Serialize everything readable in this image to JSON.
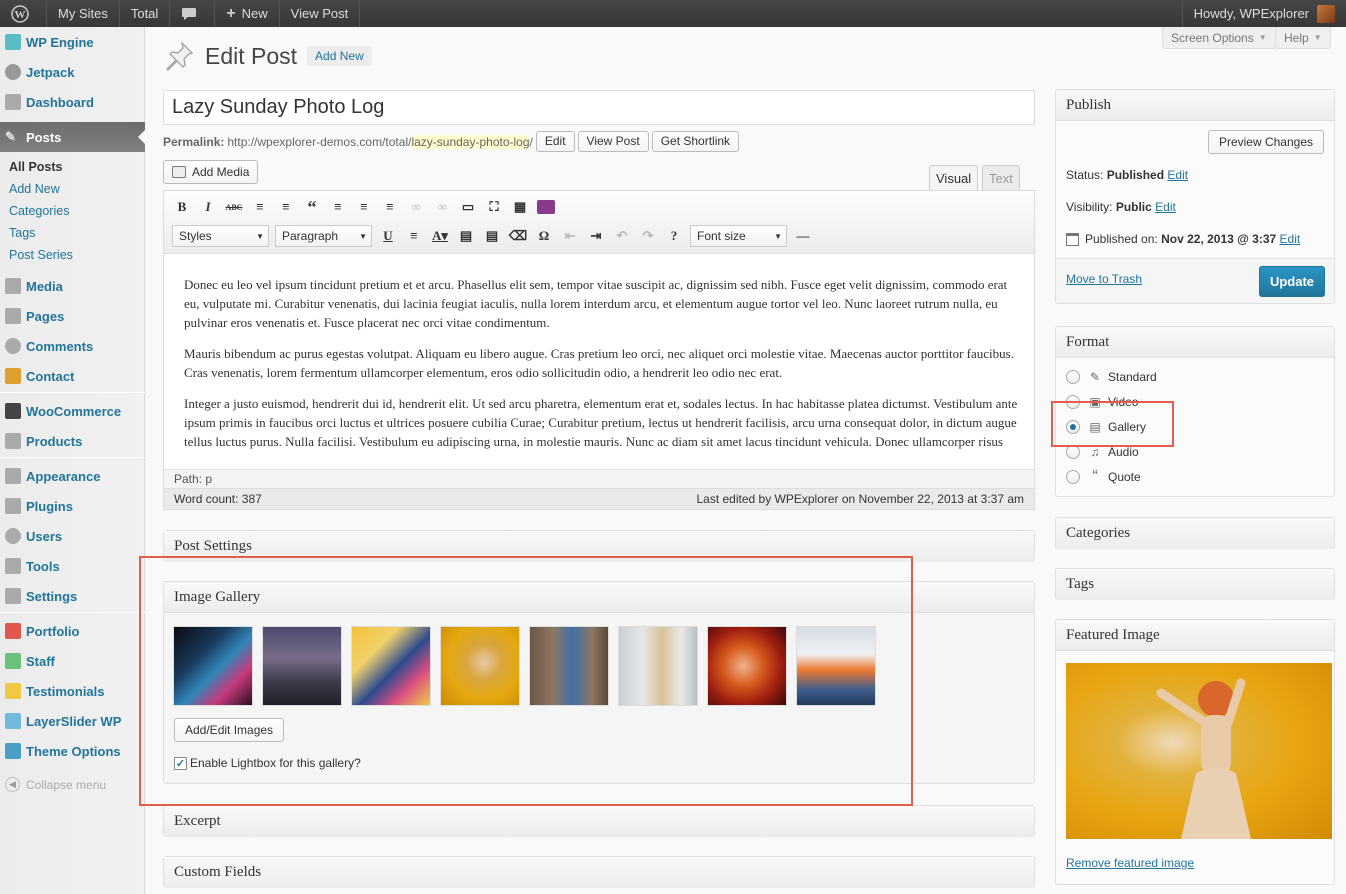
{
  "adminbar": {
    "my_sites": "My Sites",
    "site": "Total",
    "new": "New",
    "view_post": "View Post",
    "howdy": "Howdy, WPExplorer"
  },
  "sidebar": {
    "items": [
      {
        "label": "WP Engine",
        "icon": "wp-engine-icon",
        "color": "#5bbcc6"
      },
      {
        "label": "Jetpack",
        "icon": "jetpack-icon",
        "color": "#888888"
      },
      {
        "label": "Dashboard",
        "icon": "dashboard-icon",
        "color": "#888888"
      },
      {
        "label": "Posts",
        "icon": "pushpin-icon",
        "color": "#dddddd"
      },
      {
        "label": "Media",
        "icon": "media-icon",
        "color": "#888888"
      },
      {
        "label": "Pages",
        "icon": "pages-icon",
        "color": "#888888"
      },
      {
        "label": "Comments",
        "icon": "comments-icon",
        "color": "#888888"
      },
      {
        "label": "Contact",
        "icon": "contact-icon",
        "color": "#e0a030"
      },
      {
        "label": "WooCommerce",
        "icon": "woocommerce-icon",
        "color": "#444444"
      },
      {
        "label": "Products",
        "icon": "products-icon",
        "color": "#888888"
      },
      {
        "label": "Appearance",
        "icon": "appearance-icon",
        "color": "#888888"
      },
      {
        "label": "Plugins",
        "icon": "plugins-icon",
        "color": "#888888"
      },
      {
        "label": "Users",
        "icon": "users-icon",
        "color": "#888888"
      },
      {
        "label": "Tools",
        "icon": "tools-icon",
        "color": "#888888"
      },
      {
        "label": "Settings",
        "icon": "settings-icon",
        "color": "#888888"
      },
      {
        "label": "Portfolio",
        "icon": "portfolio-icon",
        "color": "#e2574c"
      },
      {
        "label": "Staff",
        "icon": "staff-icon",
        "color": "#6cc17a"
      },
      {
        "label": "Testimonials",
        "icon": "testimonials-icon",
        "color": "#f2c744"
      },
      {
        "label": "LayerSlider WP",
        "icon": "layerslider-icon",
        "color": "#72b9dc"
      },
      {
        "label": "Theme Options",
        "icon": "theme-options-icon",
        "color": "#4a9fc9"
      }
    ],
    "posts_sub": [
      "All Posts",
      "Add New",
      "Categories",
      "Tags",
      "Post Series"
    ],
    "collapse": "Collapse menu"
  },
  "header": {
    "screen_options": "Screen Options",
    "help": "Help",
    "title": "Edit Post",
    "add_new": "Add New"
  },
  "post": {
    "title": "Lazy Sunday Photo Log",
    "permalink_label": "Permalink:",
    "permalink_base": "http://wpexplorer-demos.com/total/",
    "permalink_slug": "lazy-sunday-photo-log",
    "permalink_end": "/",
    "edit": "Edit",
    "view_post": "View Post",
    "get_shortlink": "Get Shortlink"
  },
  "editor": {
    "add_media": "Add Media",
    "tab_visual": "Visual",
    "tab_text": "Text",
    "styles": "Styles",
    "paragraph": "Paragraph",
    "font_size": "Font size",
    "paragraphs": [
      "Donec eu leo vel ipsum tincidunt pretium et et arcu. Phasellus elit sem, tempor vitae suscipit ac, dignissim sed nibh. Fusce eget velit dignissim, commodo erat eu, vulputate mi. Curabitur venenatis, dui lacinia feugiat iaculis, nulla lorem interdum arcu, et elementum augue tortor vel leo. Nunc laoreet rutrum nulla, eu pulvinar eros venenatis et. Fusce placerat nec orci vitae condimentum.",
      "Mauris bibendum ac purus egestas volutpat. Aliquam eu libero augue. Cras pretium leo orci, nec aliquet orci molestie vitae. Maecenas auctor porttitor faucibus. Cras venenatis, lorem fermentum ullamcorper elementum, eros odio sollicitudin odio, a hendrerit leo odio nec erat.",
      "Integer a justo euismod, hendrerit dui id, hendrerit elit. Ut sed arcu pharetra, elementum erat et, sodales lectus. In hac habitasse platea dictumst. Vestibulum ante ipsum primis in faucibus orci luctus et ultrices posuere cubilia Curae; Curabitur pretium, lectus ut hendrerit facilisis, arcu urna consequat dolor, in dictum augue tellus luctus purus. Nulla facilisi. Vestibulum eu adipiscing urna, in molestie mauris. Nunc ac diam sit amet lacus tincidunt vehicula. Donec ullamcorper risus risus. Maecenas tempus ornare eros, ut placerat mi faucibus in."
    ],
    "path": "Path: p",
    "word_count": "Word count: 387",
    "last_edited": "Last edited by WPExplorer on November 22, 2013 at 3:37 am"
  },
  "boxes": {
    "post_settings": "Post Settings",
    "image_gallery": "Image Gallery",
    "add_edit_images": "Add/Edit Images",
    "enable_lightbox": "Enable Lightbox for this gallery?",
    "lightbox_checked": true,
    "excerpt": "Excerpt",
    "custom_fields": "Custom Fields"
  },
  "publish": {
    "title": "Publish",
    "preview": "Preview Changes",
    "status_label": "Status:",
    "status": "Published",
    "visibility_label": "Visibility:",
    "visibility": "Public",
    "published_on_label": "Published on:",
    "published_on": "Nov 22, 2013 @ 3:37",
    "edit": "Edit",
    "trash": "Move to Trash",
    "update": "Update"
  },
  "format": {
    "title": "Format",
    "options": [
      "Standard",
      "Video",
      "Gallery",
      "Audio",
      "Quote"
    ],
    "selected": "Gallery"
  },
  "categories": "Categories",
  "tags": "Tags",
  "featured": {
    "title": "Featured Image",
    "remove": "Remove featured image"
  },
  "colors": {
    "link": "#21759b",
    "highlight": "#e35d4f",
    "update": "#21759b"
  }
}
